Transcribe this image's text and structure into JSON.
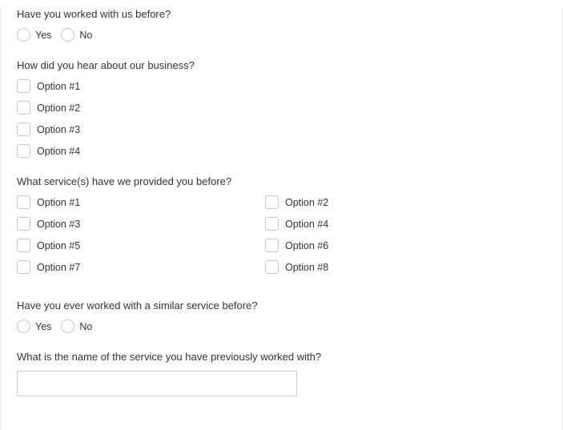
{
  "q1": {
    "question": "Have you worked with us before?",
    "options": {
      "yes": "Yes",
      "no": "No"
    }
  },
  "q2": {
    "question": "How did you hear about our business?",
    "options": [
      "Option #1",
      "Option #2",
      "Option #3",
      "Option #4"
    ]
  },
  "q3": {
    "question": "What service(s) have we provided you before?",
    "options": [
      "Option #1",
      "Option #2",
      "Option #3",
      "Option #4",
      "Option #5",
      "Option #6",
      "Option #7",
      "Option #8"
    ]
  },
  "q4": {
    "question": "Have you ever worked with a similar service before?",
    "options": {
      "yes": "Yes",
      "no": "No"
    }
  },
  "q5": {
    "question": "What is the name of the service you have previously worked with?",
    "value": ""
  }
}
